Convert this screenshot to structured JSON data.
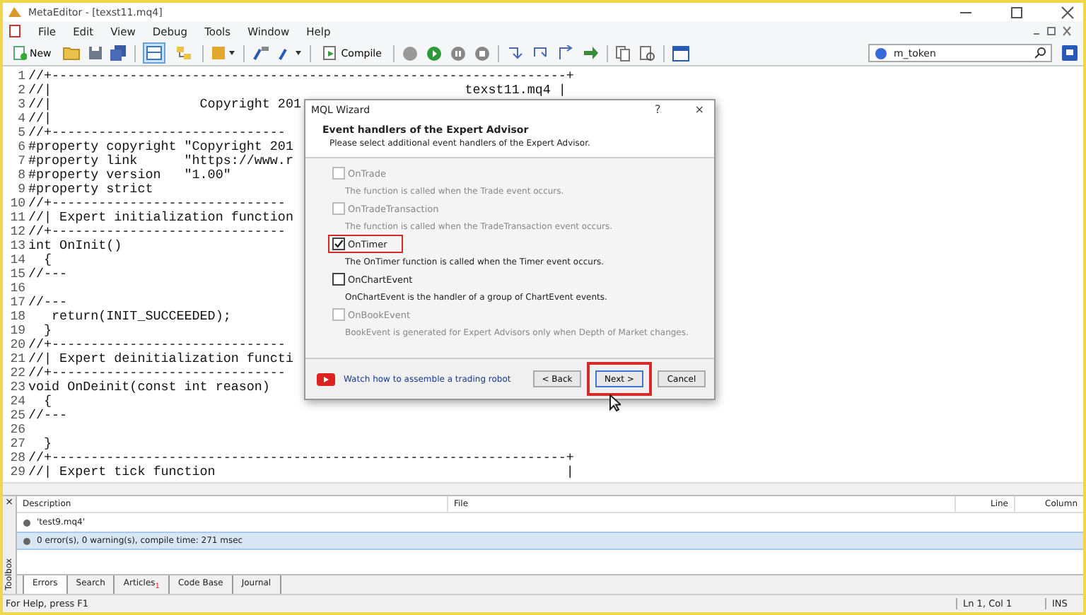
{
  "window": {
    "title": "MetaEditor - [texst11.mq4]"
  },
  "menu": [
    "File",
    "Edit",
    "View",
    "Debug",
    "Tools",
    "Window",
    "Help"
  ],
  "toolbar": {
    "new_label": "New",
    "compile_label": "Compile",
    "view_toggles": [
      {
        "selected": true
      },
      {
        "selected": false
      }
    ],
    "search": {
      "value": "m_token"
    }
  },
  "editor": {
    "lines": [
      {
        "number": "1",
        "text": "//+------------------------------------------------------------------+"
      },
      {
        "number": "2",
        "text": "//|                                                     texst11.mq4 |"
      },
      {
        "number": "3",
        "text": "//|                   Copyright 201"
      },
      {
        "number": "4",
        "text": "//|"
      },
      {
        "number": "5",
        "text": "//+------------------------------"
      },
      {
        "number": "6",
        "text": "#property copyright \"Copyright 201"
      },
      {
        "number": "7",
        "text": "#property link      \"https://www.r"
      },
      {
        "number": "8",
        "text": "#property version   \"1.00\""
      },
      {
        "number": "9",
        "text": "#property strict"
      },
      {
        "number": "10",
        "text": "//+------------------------------"
      },
      {
        "number": "11",
        "text": "//| Expert initialization function"
      },
      {
        "number": "12",
        "text": "//+------------------------------"
      },
      {
        "number": "13",
        "text": "int OnInit()"
      },
      {
        "number": "14",
        "text": "  {"
      },
      {
        "number": "15",
        "text": "//---"
      },
      {
        "number": "16"
      },
      {
        "number": "17",
        "text": "//---"
      },
      {
        "number": "18",
        "text": "   return(INIT_SUCCEEDED);"
      },
      {
        "number": "19",
        "text": "  }"
      },
      {
        "number": "20",
        "text": "//+------------------------------"
      },
      {
        "number": "21",
        "text": "//| Expert deinitialization functi"
      },
      {
        "number": "22",
        "text": "//+------------------------------"
      },
      {
        "number": "23",
        "text": "void OnDeinit(const int reason)"
      },
      {
        "number": "24",
        "text": "  {"
      },
      {
        "number": "25",
        "text": "//---"
      },
      {
        "number": "26"
      },
      {
        "number": "27",
        "text": "  }"
      },
      {
        "number": "28",
        "text": "//+------------------------------------------------------------------+"
      },
      {
        "number": "29",
        "text": "//| Expert tick function                                             |"
      }
    ]
  },
  "dialog": {
    "title": "MQL Wizard",
    "help": "?",
    "close": "×",
    "heading": "Event handlers of the Expert Advisor",
    "subheading": "Please select additional event handlers of the Expert Advisor.",
    "options": [
      {
        "label": "OnTrade",
        "description": "The function is called when the Trade event occurs.",
        "checked": false,
        "disabled": true,
        "highlighted": false
      },
      {
        "label": "OnTradeTransaction",
        "description": "The function is called when the TradeTransaction event occurs.",
        "checked": false,
        "disabled": true,
        "highlighted": false
      },
      {
        "label": "OnTimer",
        "description": "The OnTimer function is called when the Timer event occurs.",
        "checked": true,
        "disabled": false,
        "highlighted": true
      },
      {
        "label": "OnChartEvent",
        "description": "OnChartEvent is the handler of a group of ChartEvent events.",
        "checked": false,
        "disabled": false,
        "highlighted": false
      },
      {
        "label": "OnBookEvent",
        "description": "BookEvent is generated for Expert Advisors only when Depth of Market changes.",
        "checked": false,
        "disabled": true,
        "highlighted": false
      }
    ],
    "video_link": "Watch how to assemble a trading robot",
    "buttons": [
      {
        "label": "< Back",
        "default": false,
        "highlighted": false
      },
      {
        "label": "Next >",
        "default": true,
        "highlighted": true
      },
      {
        "label": "Cancel",
        "default": false,
        "highlighted": false
      }
    ]
  },
  "toolbox": {
    "label": "Toolbox",
    "close": "×",
    "columns": [
      "Description",
      "File",
      "Line",
      "Column"
    ],
    "rows": [
      {
        "description": "'test9.mq4'",
        "selected": false
      },
      {
        "description": "0 error(s), 0 warning(s), compile time: 271 msec",
        "selected": true
      }
    ],
    "tabs": [
      {
        "label": "Errors",
        "selected": true
      },
      {
        "label": "Search",
        "selected": false
      },
      {
        "label": "Articles",
        "badge": "1",
        "selected": false
      },
      {
        "label": "Code Base",
        "selected": false
      },
      {
        "label": "Journal",
        "selected": false
      }
    ]
  },
  "status_bar": {
    "help": "For Help, press F1",
    "position": "Ln 1, Col 1",
    "mode": "INS"
  }
}
